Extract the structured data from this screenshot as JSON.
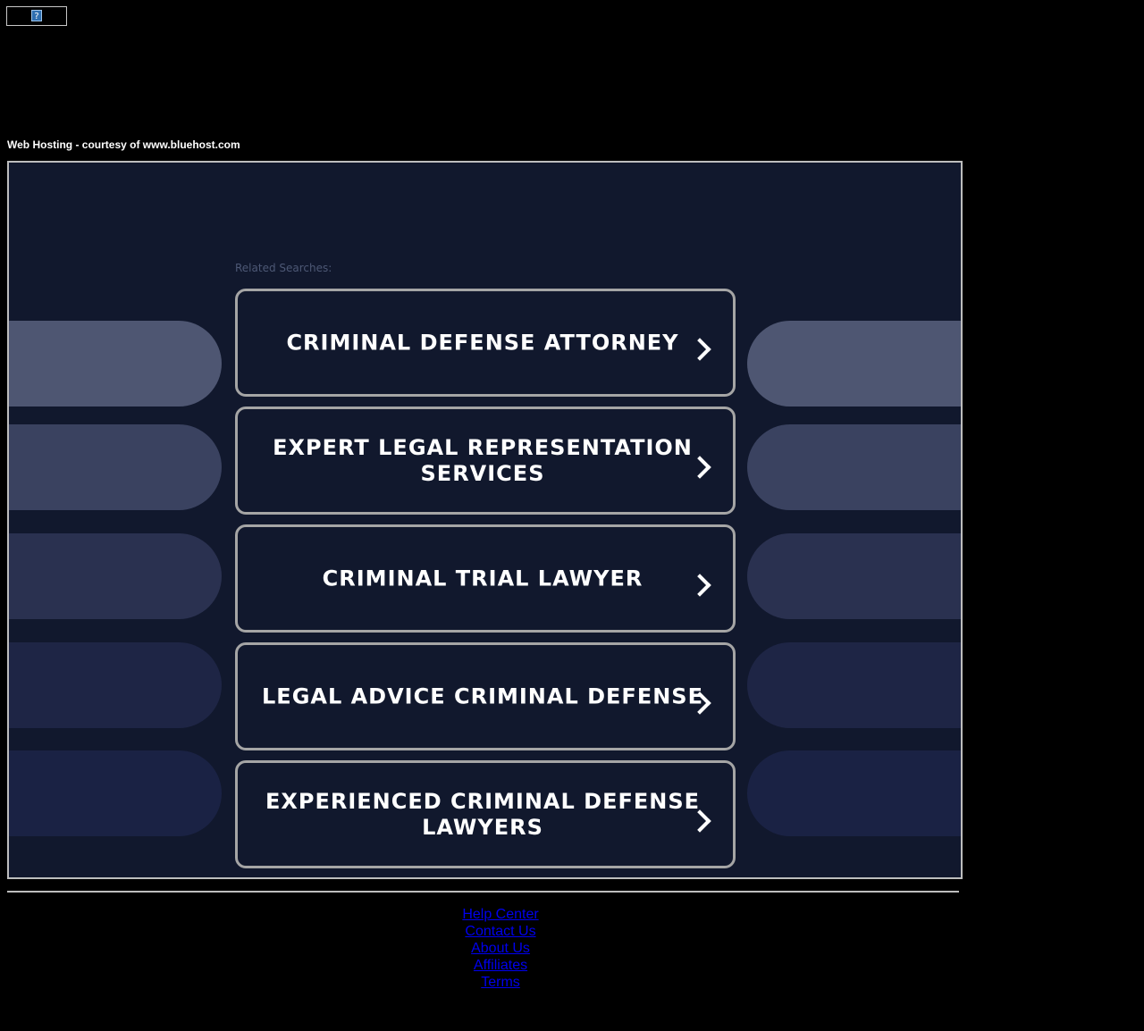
{
  "header": {
    "badge_icon": "?",
    "hosting_text": "Web Hosting - courtesy of www.bluehost.com"
  },
  "related": {
    "title": "Related Searches:",
    "items": [
      {
        "label": "CRIMINAL DEFENSE ATTORNEY"
      },
      {
        "label": "EXPERT LEGAL REPRESENTATION SERVICES"
      },
      {
        "label": "CRIMINAL TRIAL LAWYER"
      },
      {
        "label": "LEGAL ADVICE CRIMINAL DEFENSE"
      },
      {
        "label": "EXPERIENCED CRIMINAL DEFENSE LAWYERS"
      }
    ]
  },
  "footer": {
    "links": [
      {
        "label": "Help Center"
      },
      {
        "label": "Contact Us"
      },
      {
        "label": "About Us"
      },
      {
        "label": "Affiliates"
      },
      {
        "label": "Terms"
      }
    ]
  },
  "colors": {
    "page_bg": "#000000",
    "panel_bg": "#11182d",
    "card_border": "#a5a5a5",
    "link": "#0000ee",
    "side_pills": [
      "#4e5672",
      "#3a4260",
      "#2a3150",
      "#1e2545",
      "#1a2244"
    ]
  }
}
